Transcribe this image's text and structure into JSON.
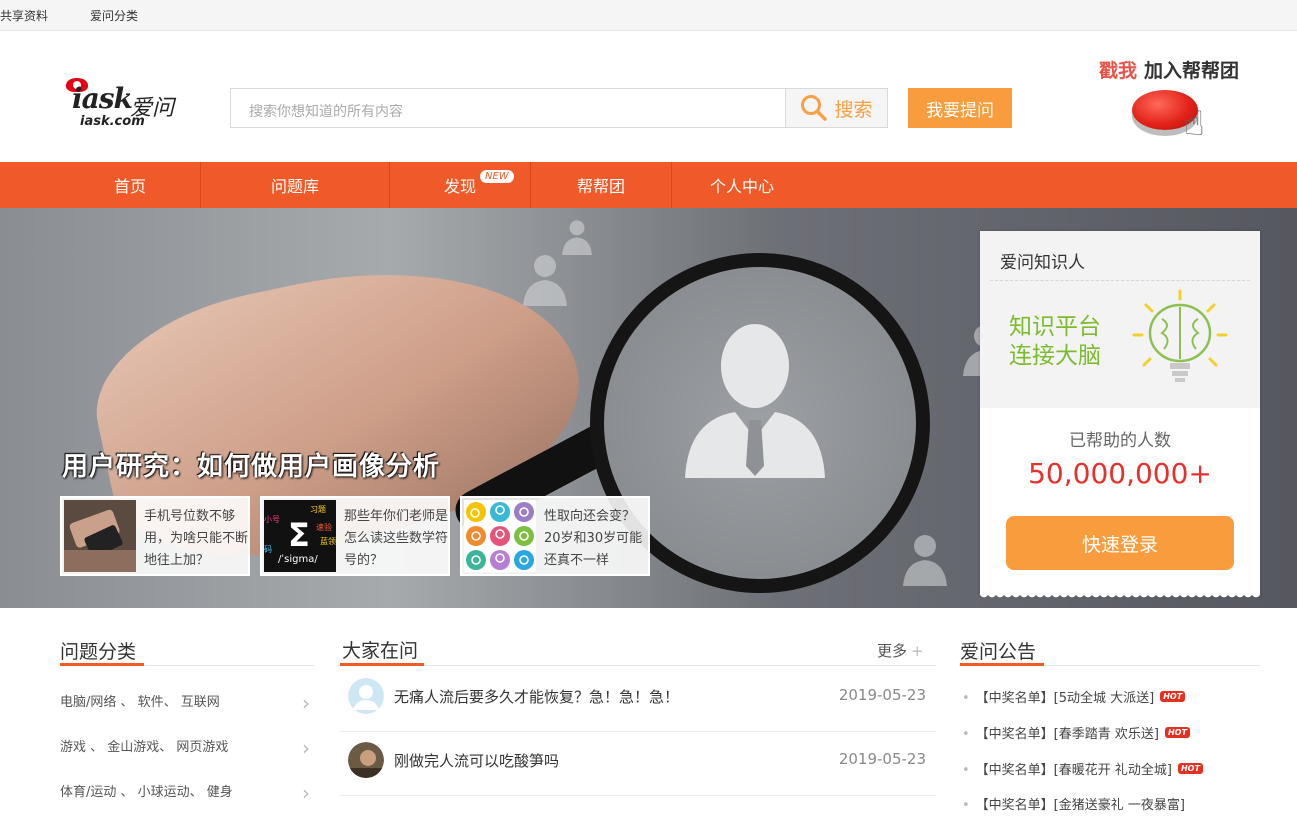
{
  "topbar": {
    "links": [
      "共享资料",
      "爱问分类"
    ]
  },
  "header": {
    "brand": "iask",
    "brand_cn": "爱问",
    "domain": "iask.com",
    "search_placeholder": "搜索你想知道的所有内容",
    "search_label": "搜索",
    "ask_label": "我要提问",
    "join_a": "戳我",
    "join_b": "加入帮帮团"
  },
  "nav": {
    "items": [
      "首页",
      "问题库",
      "发现",
      "帮帮团",
      "个人中心"
    ],
    "new_badge": "NEW"
  },
  "banner": {
    "title": "用户研究：如何做用户画像分析",
    "cards": [
      {
        "text": "手机号位数不够用，为啥只能不断地往上加？"
      },
      {
        "text": "那些年你们老师是怎么读这些数学符号的？",
        "img_label": "/ˈsigma/",
        "tags": [
          "习题",
          "速验",
          "小号",
          "蓝领",
          "码"
        ]
      },
      {
        "text": "性取向还会变？20岁和30岁可能还真不一样"
      }
    ]
  },
  "card": {
    "title": "爱问知识人",
    "slogan_1": "知识平台",
    "slogan_2": "连接大脑",
    "helped_label": "已帮助的人数",
    "count": "50,000,000+",
    "login_label": "快速登录"
  },
  "categories": {
    "title": "问题分类",
    "rows": [
      "电脑/网络 、 软件、 互联网",
      "游戏 、 金山游戏、 网页游戏",
      "体育/运动 、 小球运动、 健身"
    ]
  },
  "questions": {
    "title": "大家在问",
    "more_label": "更多",
    "items": [
      {
        "title": "无痛人流后要多久才能恢复？急！急！急！",
        "date": "2019-05-23"
      },
      {
        "title": "刚做完人流可以吃酸笋吗",
        "date": "2019-05-23"
      }
    ]
  },
  "notices": {
    "title": "爱问公告",
    "hot_label": "HOT",
    "items": [
      "【中奖名单】[5动全城 大派送]",
      "【中奖名单】[春季踏青 欢乐送]",
      "【中奖名单】[春暖花开 礼动全城]",
      "【中奖名单】[金猪送豪礼 一夜暴富]"
    ]
  },
  "colors": {
    "nav": "#f05a28",
    "accent_orange": "#f89c3d",
    "slogan_green": "#7dbb2e",
    "count_red": "#e7302a"
  }
}
